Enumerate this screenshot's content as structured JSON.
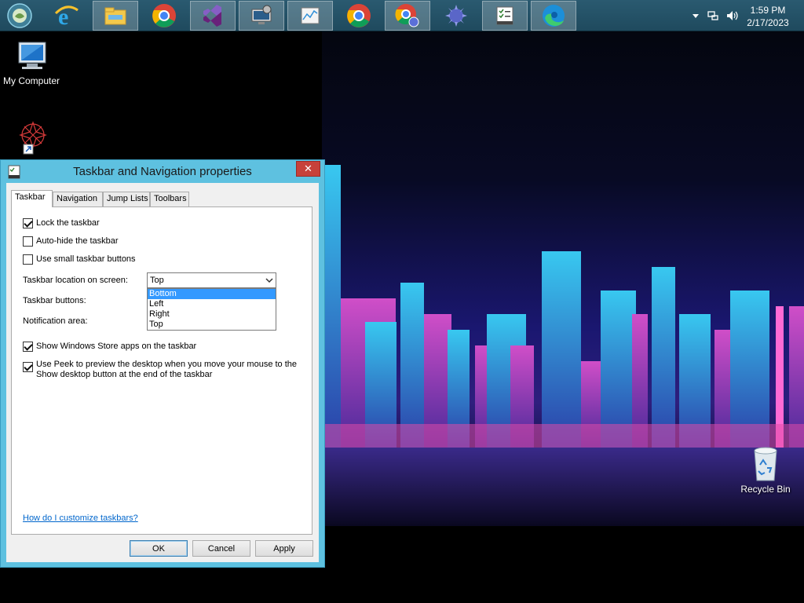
{
  "taskbar": {
    "apps": [
      {
        "name": "internet-explorer"
      },
      {
        "name": "file-explorer"
      },
      {
        "name": "chrome"
      },
      {
        "name": "visual-studio"
      },
      {
        "name": "settings-monitor"
      },
      {
        "name": "performance-monitor"
      },
      {
        "name": "chrome-2"
      },
      {
        "name": "chrome-profile"
      },
      {
        "name": "game-app"
      },
      {
        "name": "taskbar-properties"
      },
      {
        "name": "edge"
      }
    ],
    "clock": {
      "time": "1:59 PM",
      "date": "2/17/2023"
    }
  },
  "desktop": {
    "icons": [
      {
        "label": "My Computer"
      },
      {
        "label": ""
      },
      {
        "label": "Recycle Bin"
      }
    ]
  },
  "dialog": {
    "title": "Taskbar and Navigation properties",
    "close_glyph": "✕",
    "tabs": [
      "Taskbar",
      "Navigation",
      "Jump Lists",
      "Toolbars"
    ],
    "selected_tab": "Taskbar",
    "checkboxes": {
      "lock": {
        "label": "Lock the taskbar",
        "checked": true
      },
      "autohide": {
        "label": "Auto-hide the taskbar",
        "checked": false
      },
      "small": {
        "label": "Use small taskbar buttons",
        "checked": false
      },
      "store": {
        "label": "Show Windows Store apps on the taskbar",
        "checked": true
      },
      "peek": {
        "label": "Use Peek to preview the desktop when you move your mouse to the Show desktop button at the end of the taskbar",
        "checked": true
      }
    },
    "location_label": "Taskbar location on screen:",
    "location_value": "Top",
    "location_options": [
      "Bottom",
      "Left",
      "Right",
      "Top"
    ],
    "buttons_label": "Taskbar buttons:",
    "notification_label": "Notification area:",
    "help_link": "How do I customize taskbars?",
    "ok": "OK",
    "cancel": "Cancel",
    "apply": "Apply"
  }
}
